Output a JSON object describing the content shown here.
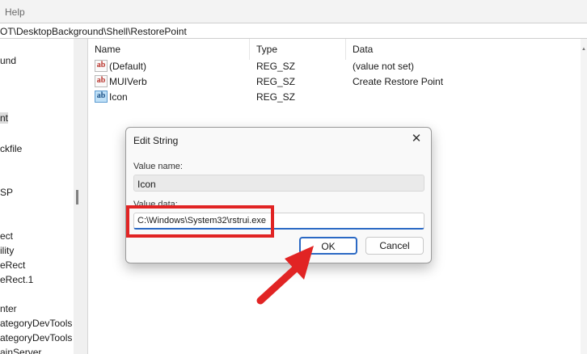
{
  "menubar": {
    "help_label": "Help"
  },
  "address": {
    "path": "OT\\DesktopBackground\\Shell\\RestorePoint"
  },
  "tree": {
    "items": [
      "und",
      "nt",
      "ckfile",
      "SP",
      "ect",
      "ility",
      "eRect",
      "eRect.1",
      "nter",
      "ategoryDevTools",
      "ategoryDevTools",
      "ainServer"
    ]
  },
  "list": {
    "columns": [
      "Name",
      "Type",
      "Data"
    ],
    "rows": [
      {
        "name": "(Default)",
        "type": "REG_SZ",
        "data": "(value not set)",
        "icon": "string-value-icon"
      },
      {
        "name": "MUIVerb",
        "type": "REG_SZ",
        "data": "Create Restore Point",
        "icon": "string-value-icon"
      },
      {
        "name": "Icon",
        "type": "REG_SZ",
        "data": "",
        "icon": "string-value-icon"
      }
    ]
  },
  "dialog": {
    "title": "Edit String",
    "close_glyph": "✕",
    "value_name_label": "Value name:",
    "value_name": "Icon",
    "value_data_label": "Value data:",
    "value_data": "C:\\Windows\\System32\\rstrui.exe",
    "ok_label": "OK",
    "cancel_label": "Cancel"
  },
  "colors": {
    "annotation": "#e12424",
    "accent": "#2b69c4"
  }
}
